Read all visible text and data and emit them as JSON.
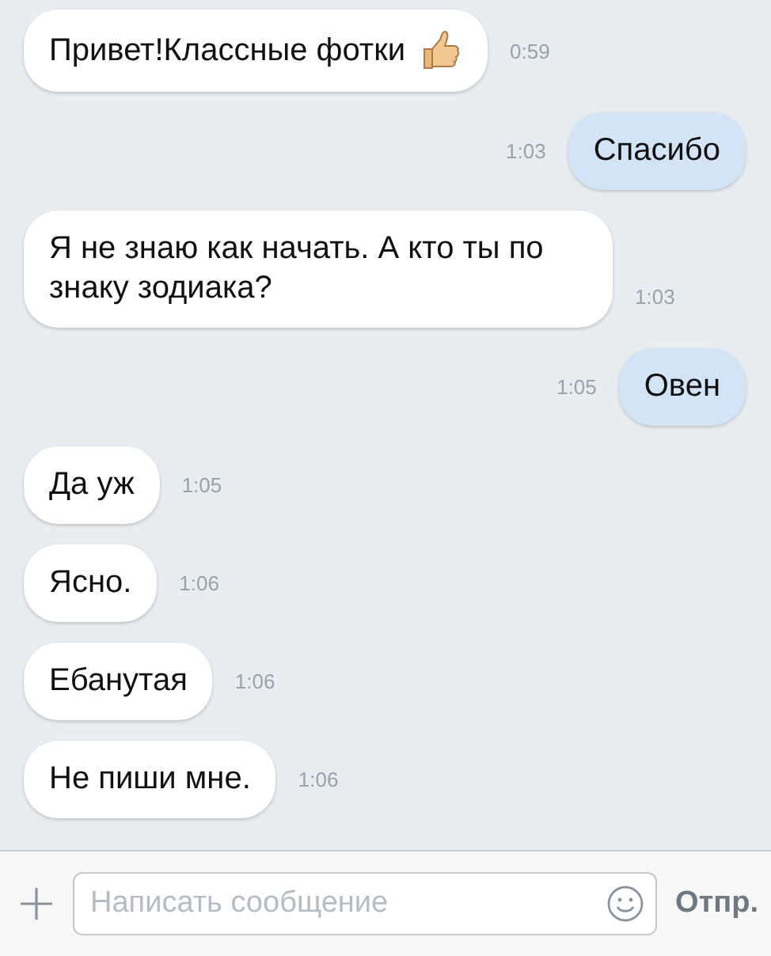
{
  "messages": [
    {
      "kind": "incoming",
      "text": "Привет!Классные фотки",
      "time": "0:59"
    },
    {
      "kind": "outgoing",
      "text": "Спасибо",
      "time": "1:03"
    },
    {
      "kind": "incoming",
      "text": "Я не знаю как начать. А кто ты по знаку зодиака?",
      "time": "1:03"
    },
    {
      "kind": "outgoing",
      "text": "Овен",
      "time": "1:05"
    },
    {
      "kind": "incoming",
      "text": "Да уж",
      "time": "1:05"
    },
    {
      "kind": "incoming",
      "text": "Ясно.",
      "time": "1:06"
    },
    {
      "kind": "incoming",
      "text": "Ебанутая",
      "time": "1:06"
    },
    {
      "kind": "incoming",
      "text": "Не пиши мне.",
      "time": "1:06"
    }
  ],
  "composer": {
    "placeholder": "Написать сообщение",
    "send_label": "Отпр."
  }
}
